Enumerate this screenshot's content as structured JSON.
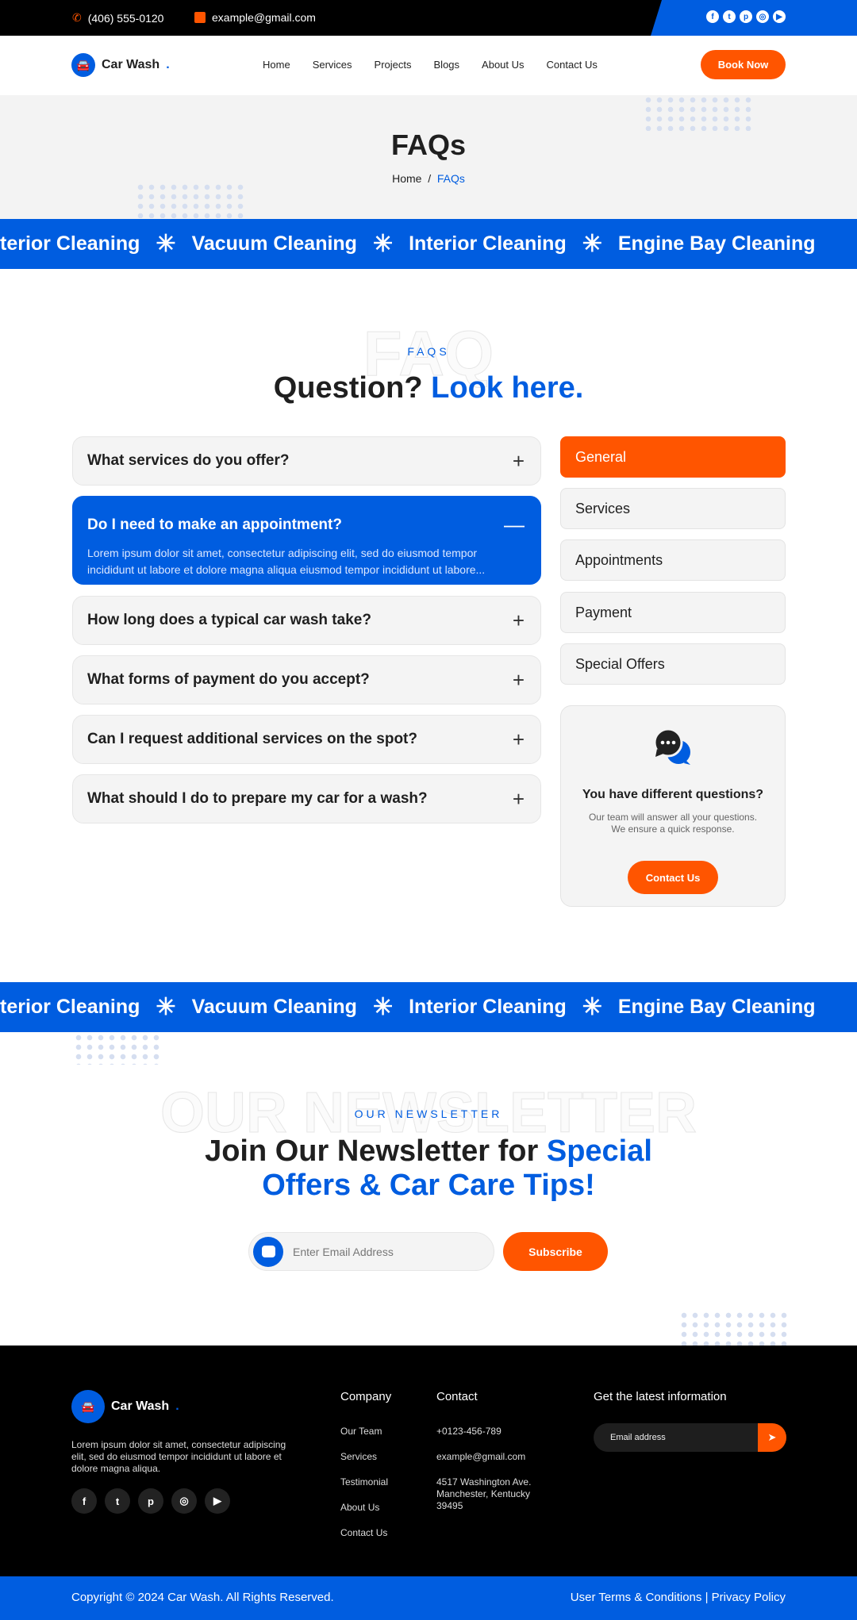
{
  "topbar": {
    "phone": "(406) 555-0120",
    "email": "example@gmail.com",
    "socials": [
      "facebook",
      "twitter",
      "pinterest",
      "instagram",
      "youtube"
    ]
  },
  "nav": {
    "logo": "Car Wash",
    "logo_dot": ".",
    "links": [
      "Home",
      "Services",
      "Projects",
      "Blogs",
      "About Us",
      "Contact Us"
    ],
    "cta": "Book Now"
  },
  "hero": {
    "title": "FAQs",
    "crumb_home": "Home",
    "crumb_sep": "/",
    "crumb_current": "FAQs"
  },
  "marquee": [
    "terior Cleaning",
    "Vacuum Cleaning",
    "Interior Cleaning",
    "Engine Bay Cleaning"
  ],
  "faq": {
    "watermark": "FAQ",
    "label": "FAQS",
    "heading_a": "Question?",
    "heading_b": "Look here.",
    "items": [
      {
        "q": "What services do you offer?"
      },
      {
        "q": "Do I need to make an appointment?",
        "a": "Lorem ipsum dolor sit amet, consectetur adipiscing elit, sed do eiusmod tempor incididunt ut labore et dolore magna aliqua eiusmod tempor incididunt ut labore..."
      },
      {
        "q": "How long does a typical car wash take?"
      },
      {
        "q": "What forms of payment do you accept?"
      },
      {
        "q": "Can I request additional services on the spot?"
      },
      {
        "q": "What should I do to prepare my car for a wash?"
      }
    ],
    "categories": [
      "General",
      "Services",
      "Appointments",
      "Payment",
      "Special Offers"
    ],
    "card": {
      "title": "You have different questions?",
      "line1": "Our team will answer all your questions.",
      "line2": "We ensure a quick response.",
      "button": "Contact Us"
    }
  },
  "newsletter": {
    "watermark": "OUR NEWSLETTER",
    "label": "OUR NEWSLETTER",
    "heading_a": "Join Our Newsletter for",
    "heading_b": "Special",
    "heading_c": "Offers & Car Care Tips!",
    "placeholder": "Enter Email Address",
    "button": "Subscribe"
  },
  "footer": {
    "logo": "Car Wash",
    "about": "Lorem ipsum dolor sit amet, consectetur adipiscing elit, sed do eiusmod tempor incididunt ut labore et dolore magna aliqua.",
    "company_title": "Company",
    "company": [
      "Our Team",
      "Services",
      "Testimonial",
      "About Us",
      "Contact Us"
    ],
    "contact_title": "Contact",
    "phone": "+0123-456-789",
    "email": "example@gmail.com",
    "address": "4517 Washington Ave. Manchester, Kentucky 39495",
    "news_title": "Get the latest information",
    "news_placeholder": "Email address",
    "copyright": "Copyright © 2024 Car Wash. All Rights Reserved.",
    "terms": "User Terms & Conditions",
    "sep": "|",
    "privacy": "Privacy Policy"
  },
  "colors": {
    "primary": "#005de0",
    "accent": "#ff5500"
  }
}
